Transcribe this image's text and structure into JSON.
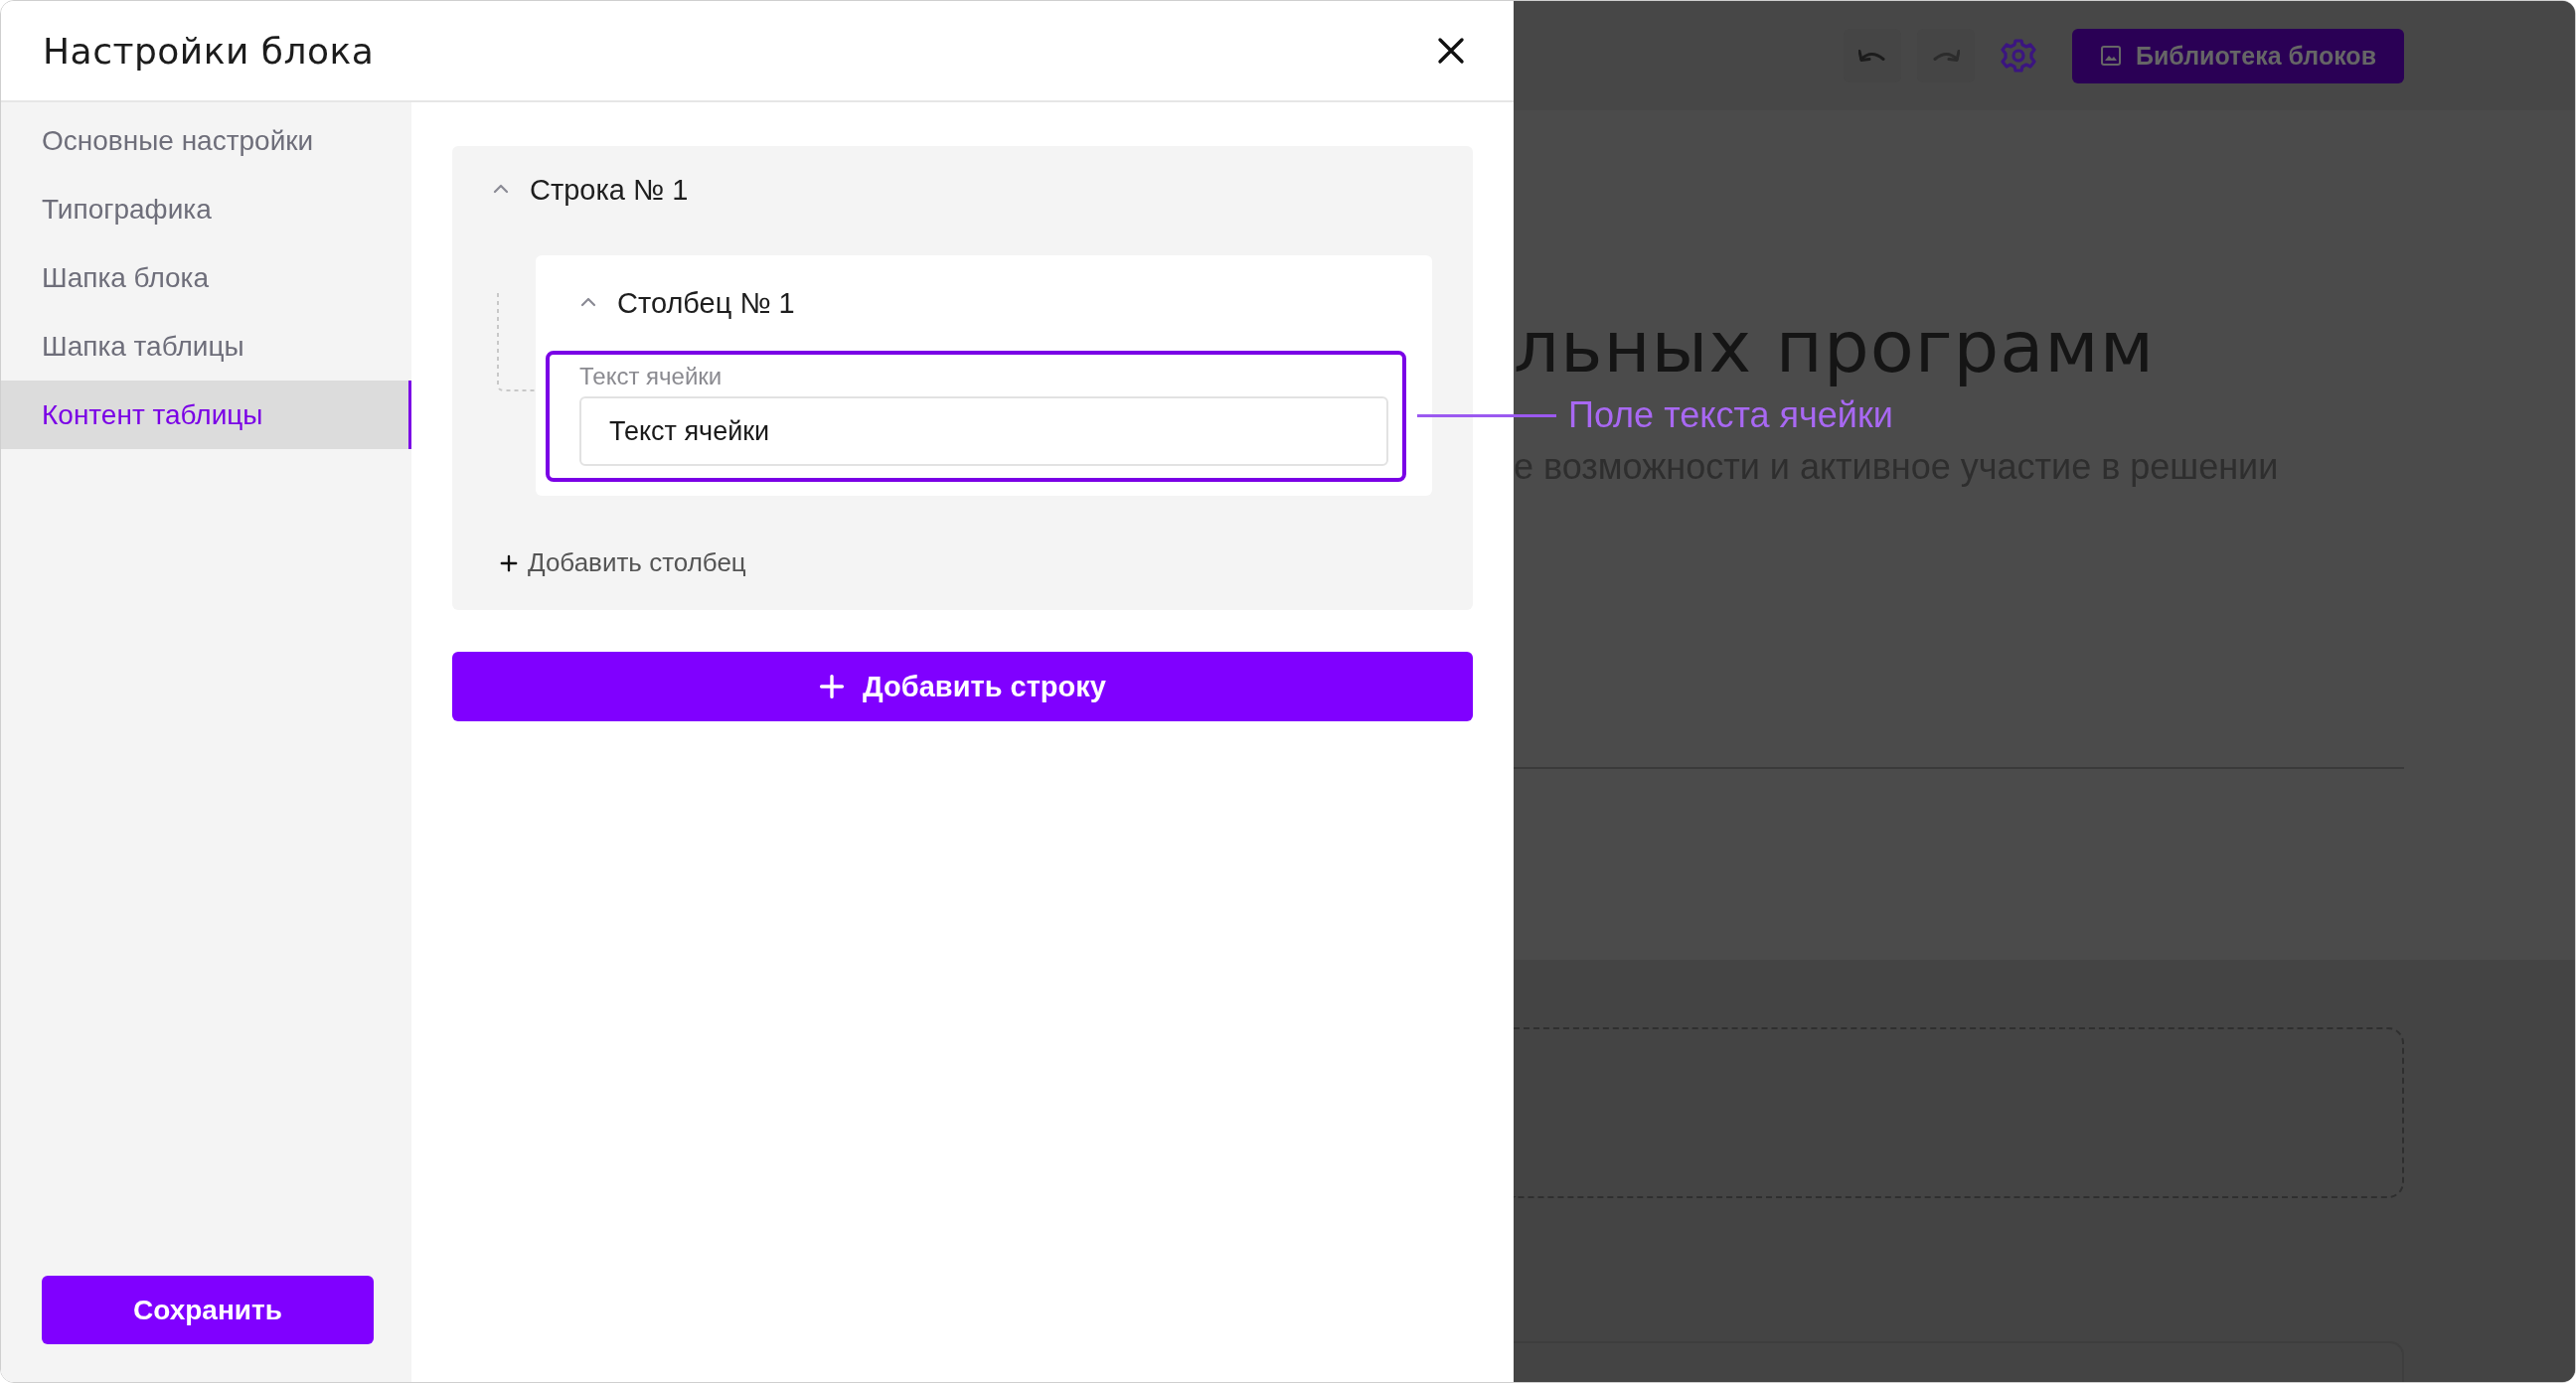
{
  "modal": {
    "title": "Настройки блока",
    "sidebar": {
      "items": [
        {
          "label": "Основные настройки",
          "selected": false
        },
        {
          "label": "Типографика",
          "selected": false
        },
        {
          "label": "Шапка блока",
          "selected": false
        },
        {
          "label": "Шапка таблицы",
          "selected": false
        },
        {
          "label": "Контент таблицы",
          "selected": true
        }
      ],
      "save_button": "Сохранить"
    },
    "content": {
      "rows": [
        {
          "title": "Строка № 1",
          "expanded": true,
          "columns": [
            {
              "title": "Столбец № 1",
              "expanded": true,
              "field": {
                "label": "Текст ячейки",
                "value": "Текст ячейки",
                "highlighted": true
              }
            }
          ],
          "add_column": "Добавить столбец"
        }
      ],
      "add_row": "Добавить строку"
    }
  },
  "backdrop": {
    "library_button": "Библиотека блоков",
    "heading": "льных программ",
    "subtitle": "е возможности и активное участие в решении"
  },
  "annotation": {
    "label": "Поле текста ячейки"
  }
}
